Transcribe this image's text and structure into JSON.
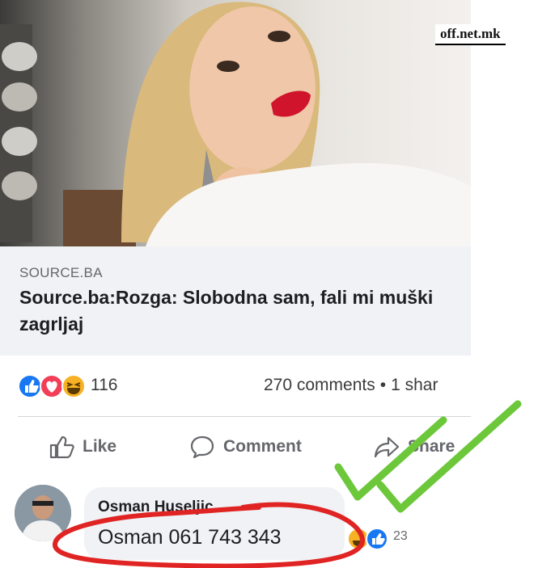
{
  "watermark": "off.net.mk",
  "link_preview": {
    "source": "SOURCE.BA",
    "headline": "Source.ba:Rozga: Slobodna sam, fali mi muški zagrljaj"
  },
  "reactions": {
    "icons": [
      "like-icon",
      "love-icon",
      "haha-icon"
    ],
    "count": "116"
  },
  "stats": {
    "comments": "270 comments",
    "separator": "•",
    "shares": "1 shar"
  },
  "actions": {
    "like": "Like",
    "comment": "Comment",
    "share": "Share"
  },
  "comment": {
    "author": "Osman Huseljic",
    "text": "Osman 061 743 343",
    "reaction_icons": [
      "haha-icon",
      "like-icon"
    ],
    "reaction_count": "23"
  },
  "colors": {
    "facebook_blue": "#1877f2",
    "love_red": "#f33e58",
    "haha_yellow": "#f7b125",
    "annotation_red": "#e02424",
    "annotation_green": "#6cc83a"
  }
}
